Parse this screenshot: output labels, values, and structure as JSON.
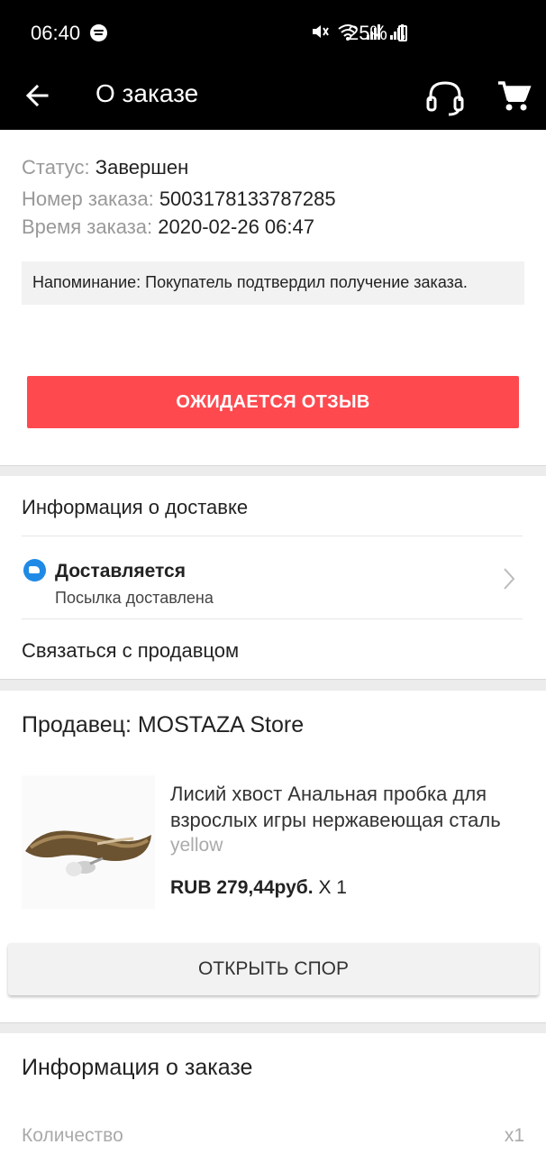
{
  "statusbar": {
    "time": "06:40",
    "battery": "25%",
    "icons": [
      "spotify-icon",
      "mute-icon",
      "wifi-icon",
      "signal-icon",
      "signal-icon",
      "battery-icon"
    ]
  },
  "appbar": {
    "title": "О заказе",
    "icons": [
      "back-arrow-icon",
      "headset-icon",
      "cart-icon"
    ]
  },
  "order": {
    "status_label": "Статус:",
    "status_value": "Завершен",
    "number_label": "Номер заказа:",
    "number_value": "5003178133787285",
    "time_label": "Время заказа:",
    "time_value": "2020-02-26 06:47",
    "reminder": "Напоминание: Покупатель подтвердил получение заказа.",
    "review_button": "ОЖИДАЕТСЯ ОТЗЫВ"
  },
  "delivery": {
    "header": "Информация о доставке",
    "status": "Доставляется",
    "substatus": "Посылка доставлена",
    "contact_seller": "Связаться с продавцом"
  },
  "seller": {
    "name": "Продавец: MOSTAZA Store",
    "product": {
      "title_line1": "Лисий хвост Анальная пробка для",
      "title_line2": "взрослых игры нержавеющая сталь",
      "variant": "yellow",
      "price": "RUB 279,44руб.",
      "quantity": " X 1"
    },
    "dispute_button": "ОТКРЫТЬ СПОР"
  },
  "order_info": {
    "header": "Информация о заказе",
    "quantity_label": "Количество",
    "quantity_value": "x1"
  },
  "colors": {
    "accent": "#fe4a4f",
    "header_bg": "#000000",
    "delivery_icon": "#1f8ae6"
  }
}
